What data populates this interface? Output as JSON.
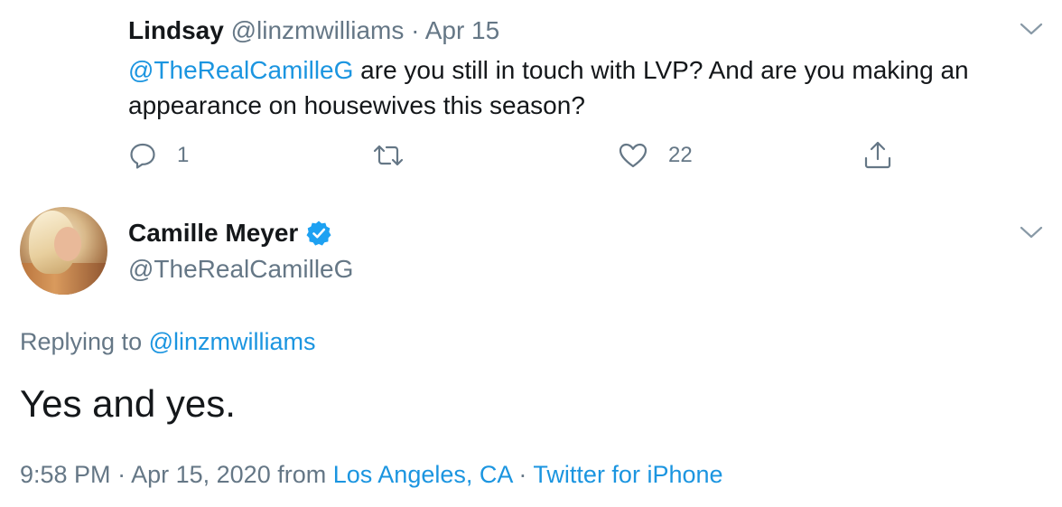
{
  "reply_tweet": {
    "author_name": "Lindsay",
    "author_handle": "@linzmwilliams",
    "separator": "·",
    "date": "Apr 15",
    "mention": "@TheRealCamilleG",
    "text": " are you still in touch with LVP? And are you making an appearance on housewives this season?",
    "actions": {
      "reply_count": "1",
      "like_count": "22"
    }
  },
  "main_tweet": {
    "author_name": "Camille Meyer",
    "author_handle": "@TheRealCamilleG",
    "replying_to_label": "Replying to ",
    "replying_to_handle": "@linzmwilliams",
    "text": "Yes and yes.",
    "time": "9:58 PM",
    "separator": "·",
    "date": "Apr 15, 2020",
    "from_label": "from",
    "location": "Los Angeles, CA",
    "source": "Twitter for iPhone"
  },
  "colors": {
    "text": "#14171a",
    "muted": "#657786",
    "link": "#1b95e0",
    "verified": "#1da1f2"
  }
}
